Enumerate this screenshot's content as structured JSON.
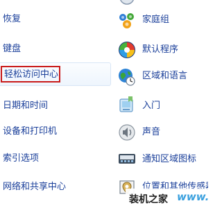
{
  "left_items": [
    {
      "label": "恢复"
    },
    {
      "label": "键盘"
    },
    {
      "label": "轻松访问中心"
    },
    {
      "label": "日期和时间"
    },
    {
      "label": "设备和打印机"
    },
    {
      "label": "索引选项"
    },
    {
      "label": "网络和共享中心"
    }
  ],
  "right_items": [
    {
      "label": "家庭组",
      "icon": "homegroup-icon"
    },
    {
      "label": "默认程序",
      "icon": "default-programs-icon"
    },
    {
      "label": "区域和语言",
      "icon": "region-language-icon"
    },
    {
      "label": "入门",
      "icon": "getting-started-icon"
    },
    {
      "label": "声音",
      "icon": "sound-icon"
    },
    {
      "label": "通知区域图标",
      "icon": "notification-area-icon"
    },
    {
      "label": "位置和其他传感器",
      "icon": "location-sensors-icon"
    }
  ],
  "highlight_color": "#c91a1a",
  "link_color": "#1a3f9a",
  "watermark": {
    "text_cn": "装机之家",
    "text_en": "www.lot"
  }
}
